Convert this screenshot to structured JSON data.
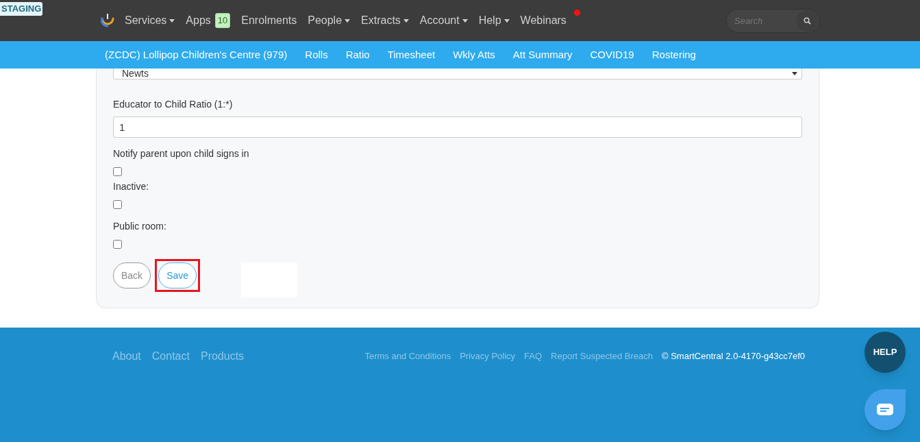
{
  "staging_badge": "STAGING",
  "nav": {
    "items": [
      {
        "label": "Services",
        "dropdown": true
      },
      {
        "label": "Apps",
        "badge": "10",
        "dropdown": false
      },
      {
        "label": "Enrolments",
        "dropdown": false
      },
      {
        "label": "People",
        "dropdown": true
      },
      {
        "label": "Extracts",
        "dropdown": true
      },
      {
        "label": "Account",
        "dropdown": true
      },
      {
        "label": "Help",
        "dropdown": true
      },
      {
        "label": "Webinars",
        "dropdown": false,
        "notification": true
      }
    ],
    "search": {
      "placeholder": "Search"
    }
  },
  "subnav": {
    "items": [
      "(ZCDC) Lollipop Children's Centre (979)",
      "Rolls",
      "Ratio",
      "Timesheet",
      "Wkly Atts",
      "Att Summary",
      "COVID19",
      "Rostering"
    ]
  },
  "form": {
    "fields": [
      {
        "kind": "select",
        "value": "Newts"
      },
      {
        "kind": "text",
        "label": "Educator to Child Ratio (1:*)",
        "value": "1"
      },
      {
        "kind": "checkbox",
        "label": "Notify parent upon child signs in",
        "checked": false
      },
      {
        "kind": "checkbox",
        "label": "Inactive:",
        "checked": false
      },
      {
        "kind": "checkbox",
        "label": "Public room:",
        "checked": false
      }
    ],
    "buttons": [
      {
        "label": "Back",
        "kind": "secondary",
        "highlighted": false
      },
      {
        "label": "Save",
        "kind": "primary",
        "highlighted": true
      }
    ]
  },
  "footer": {
    "links": [
      "About",
      "Contact",
      "Products"
    ],
    "legal_links": [
      "Terms and Conditions",
      "Privacy Policy",
      "FAQ",
      "Report Suspected Breach"
    ],
    "copyright": "© SmartCentral 2.0-4170-g43cc7ef0"
  },
  "help_button": "HELP"
}
